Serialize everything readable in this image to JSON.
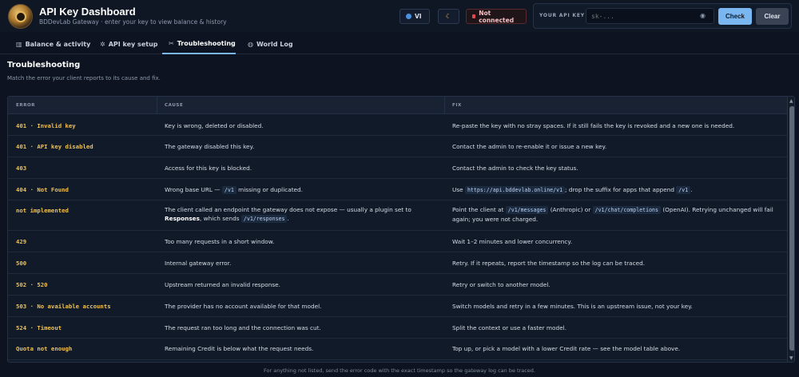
{
  "header": {
    "title": "API Key Dashboard",
    "subtitle": "BDDevLab Gateway · enter your key to view balance & history",
    "lang_label": "VI",
    "status_label": "Not connected",
    "key_label": "YOUR API KEY",
    "key_placeholder": "sk-...",
    "check_label": "Check",
    "clear_label": "Clear"
  },
  "tabs": [
    {
      "label": "Balance & activity",
      "icon": "chart-icon"
    },
    {
      "label": "API key setup",
      "icon": "gear-icon"
    },
    {
      "label": "Troubleshooting",
      "icon": "wrench-icon",
      "active": true
    },
    {
      "label": "World Log",
      "icon": "globe-icon"
    }
  ],
  "section": {
    "title": "Troubleshooting",
    "subtitle": "Match the error your client reports to its cause and fix."
  },
  "table": {
    "headers": [
      "ERROR",
      "CAUSE",
      "FIX"
    ],
    "rows": [
      {
        "error": "401 · Invalid key",
        "cause": "Key is wrong, deleted or disabled.",
        "fix": "Re-paste the key with no stray spaces. If it still fails the key is revoked and a new one is needed."
      },
      {
        "error": "401 · API key disabled",
        "cause": "The gateway disabled this key.",
        "fix": "Contact the admin to re-enable it or issue a new key."
      },
      {
        "error": "403",
        "cause": "Access for this key is blocked.",
        "fix": "Contact the admin to check the key status."
      },
      {
        "error": "404 · Not Found",
        "cause_pre": "Wrong base URL — ",
        "cause_code": "/v1",
        "cause_post": " missing or duplicated.",
        "fix_pre": "Use ",
        "fix_code": "https://api.bddevlab.online/v1",
        "fix_mid": "; drop the suffix for apps that append ",
        "fix_code2": "/v1",
        "fix_post": "."
      },
      {
        "error": "not implemented",
        "cause_pre": "The client called an endpoint the gateway does not expose — usually a plugin set to ",
        "cause_bold": "Responses",
        "cause_mid": ", which sends ",
        "cause_code": "/v1/responses",
        "cause_post": ".",
        "fix_pre": "Point the client at ",
        "fix_code": "/v1/messages",
        "fix_mid": " (Anthropic) or ",
        "fix_code2": "/v1/chat/completions",
        "fix_post": " (OpenAI). Retrying unchanged will fail again; you were not charged."
      },
      {
        "error": "429",
        "cause": "Too many requests in a short window.",
        "fix": "Wait 1–2 minutes and lower concurrency."
      },
      {
        "error": "500",
        "cause": "Internal gateway error.",
        "fix": "Retry. If it repeats, report the timestamp so the log can be traced."
      },
      {
        "error": "502 · 520",
        "cause": "Upstream returned an invalid response.",
        "fix": "Retry or switch to another model."
      },
      {
        "error": "503 · No available accounts",
        "cause": "The provider has no account available for that model.",
        "fix": "Switch models and retry in a few minutes. This is an upstream issue, not your key."
      },
      {
        "error": "524 · Timeout",
        "cause": "The request ran too long and the connection was cut.",
        "fix": "Split the context or use a faster model."
      },
      {
        "error": "Quota not enough",
        "cause": "Remaining Credit is below what the request needs.",
        "fix": "Top up, or pick a model with a lower Credit rate — see the model table above."
      }
    ]
  },
  "footer_note": "For anything not listed, send the error code with the exact timestamp so the gateway log can be traced."
}
